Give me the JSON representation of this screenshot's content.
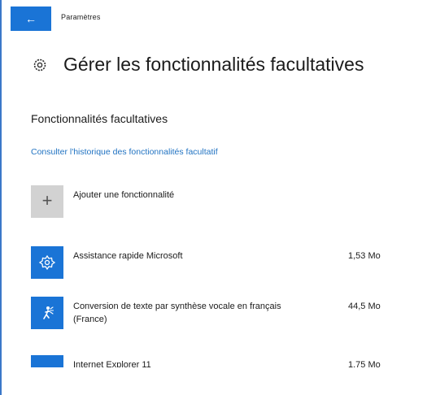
{
  "window": {
    "app_title": "Paramètres",
    "back_icon": "arrow-left"
  },
  "header": {
    "icon": "gear",
    "title": "Gérer les fonctionnalités facultatives"
  },
  "section": {
    "title": "Fonctionnalités facultatives",
    "history_link": "Consulter l'historique des fonctionnalités facultatif"
  },
  "add": {
    "icon": "plus",
    "label": "Ajouter une fonctionnalité"
  },
  "features": [
    {
      "icon": "quick-assist-icon",
      "name": "Assistance rapide Microsoft",
      "size": "1,53 Mo"
    },
    {
      "icon": "tts-person-icon",
      "name": "Conversion de texte par synthèse vocale en français (France)",
      "size": "44,5 Mo"
    },
    {
      "icon": "internet-explorer-icon",
      "name": "Internet Explorer 11",
      "size": "1,75 Mo"
    }
  ],
  "colors": {
    "accent": "#1a74d6",
    "link": "#2173c2",
    "add_tile": "#d2d2d2",
    "frame": "#3b78c9"
  }
}
